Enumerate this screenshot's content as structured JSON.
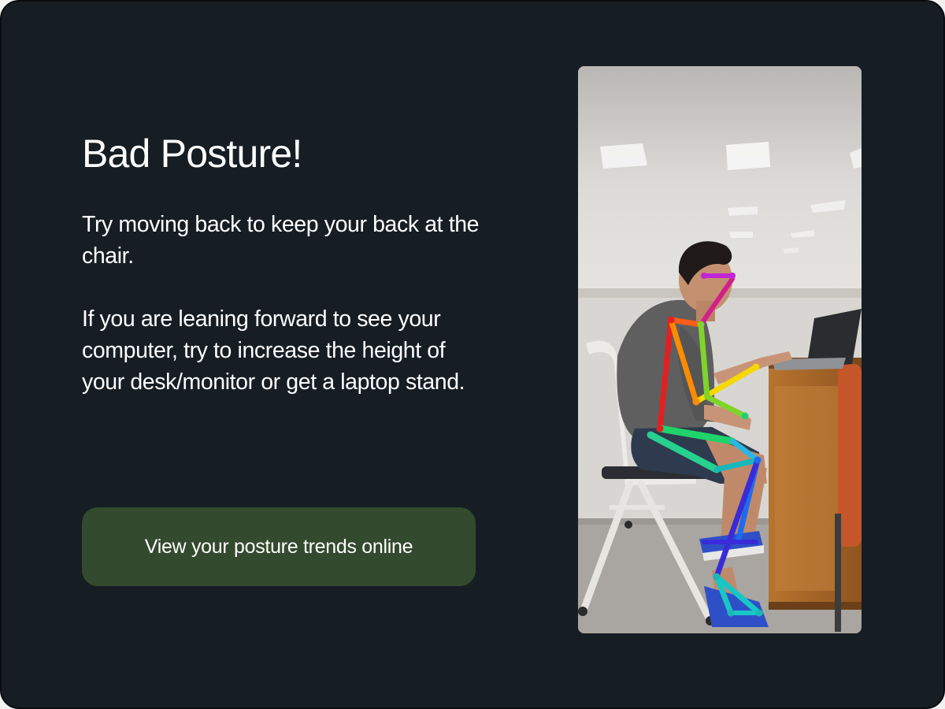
{
  "alert": {
    "title": "Bad Posture!",
    "tip_primary": "Try moving back to keep your back at the chair.",
    "tip_secondary": "If you are leaning forward to see your computer, try to increase the height of your desk/monitor or get a laptop stand."
  },
  "actions": {
    "trends_button_label": "View your posture trends online"
  },
  "photo": {
    "subject": "person seated at desk with pose-estimation skeleton overlay",
    "overlay_colors": [
      "#e32020",
      "#ff8c00",
      "#f5d800",
      "#7fd32a",
      "#1fd46a",
      "#18b8b8",
      "#1d6cf0",
      "#3a2bd8",
      "#c026d3"
    ]
  },
  "theme": {
    "background": "#161d23",
    "button_color": "#334a2e",
    "text_color": "#ffffff"
  }
}
